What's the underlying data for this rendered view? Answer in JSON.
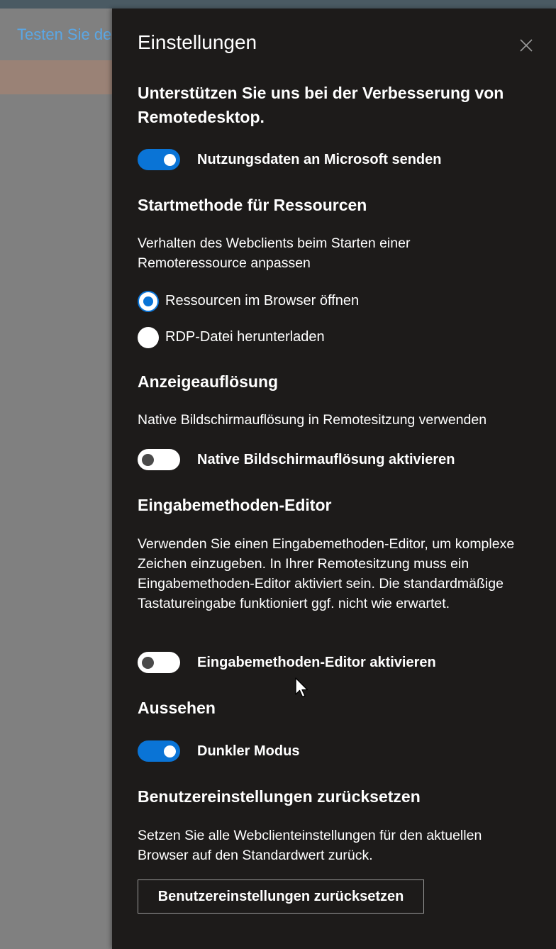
{
  "background": {
    "link_text": "Testen Sie de"
  },
  "panel": {
    "title": "Einstellungen",
    "close_icon": "close-icon"
  },
  "telemetry": {
    "heading": "Unterstützen Sie uns bei der Verbesserung von Remotedesktop.",
    "toggle_label": "Nutzungsdaten an Microsoft senden",
    "toggle_on": true
  },
  "launch_method": {
    "heading": "Startmethode für Ressourcen",
    "description": "Verhalten des Webclients beim Starten einer Remoteressource anpassen",
    "options": [
      {
        "label": "Ressourcen im Browser öffnen",
        "selected": true
      },
      {
        "label": "RDP-Datei herunterladen",
        "selected": false
      }
    ]
  },
  "resolution": {
    "heading": "Anzeigeauflösung",
    "description": "Native Bildschirmauflösung in Remotesitzung verwenden",
    "toggle_label": "Native Bildschirmauflösung aktivieren",
    "toggle_on": false
  },
  "ime": {
    "heading": "Eingabemethoden-Editor",
    "description": "Verwenden Sie einen Eingabemethoden-Editor, um komplexe Zeichen einzugeben. In Ihrer Remotesitzung muss ein Eingabemethoden-Editor aktiviert sein. Die standardmäßige Tastatureingabe funktioniert ggf. nicht wie erwartet.",
    "toggle_label": "Eingabemethoden-Editor aktivieren",
    "toggle_on": false
  },
  "appearance": {
    "heading": "Aussehen",
    "toggle_label": "Dunkler Modus",
    "toggle_on": true
  },
  "reset": {
    "heading": "Benutzereinstellungen zurücksetzen",
    "description": "Setzen Sie alle Webclienteinstellungen für den aktuellen Browser auf den Standardwert zurück.",
    "button_label": "Benutzereinstellungen zurücksetzen"
  },
  "colors": {
    "panel_bg": "#1d1b1a",
    "accent": "#0a74d6",
    "backdrop": "#808080",
    "link": "#5aa7e6"
  }
}
